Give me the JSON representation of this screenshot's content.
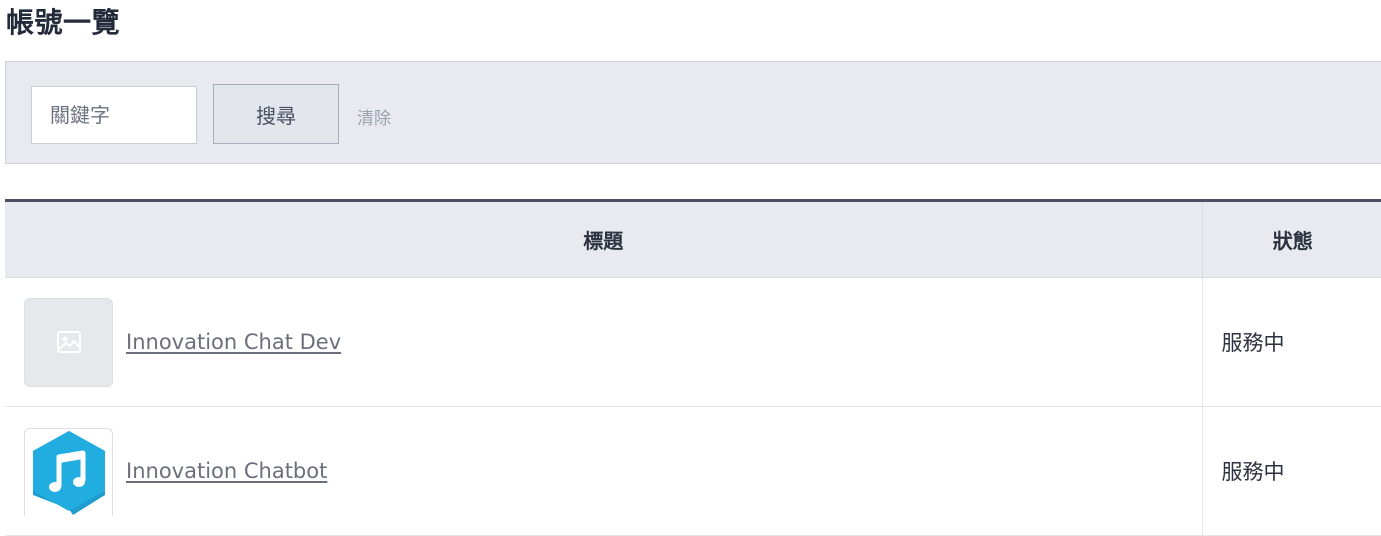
{
  "page": {
    "title": "帳號一覽"
  },
  "search": {
    "placeholder": "關鍵字",
    "value": "",
    "search_label": "搜尋",
    "clear_label": "清除"
  },
  "table": {
    "columns": {
      "title": "標題",
      "status": "狀態"
    },
    "rows": [
      {
        "name": "Innovation Chat Dev",
        "status": "服務中",
        "icon": "image-placeholder-icon"
      },
      {
        "name": "Innovation Chatbot",
        "status": "服務中",
        "icon": "music-note-icon"
      }
    ]
  },
  "colors": {
    "heading": "#232a3a",
    "panel_bg": "#e8eaef",
    "table_header_top_border": "#4a5063",
    "link": "#69707c",
    "brand_icon": "#1aa7d8"
  }
}
